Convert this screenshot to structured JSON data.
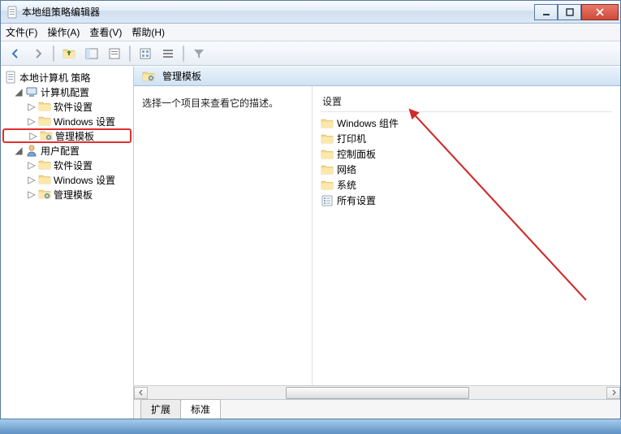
{
  "window": {
    "title": "本地组策略编辑器"
  },
  "menu": {
    "file": "文件(F)",
    "action": "操作(A)",
    "view": "查看(V)",
    "help": "帮助(H)"
  },
  "tree": {
    "root": "本地计算机 策略",
    "computer_config": "计算机配置",
    "user_config": "用户配置",
    "software_settings": "软件设置",
    "windows_settings": "Windows 设置",
    "admin_templates": "管理模板"
  },
  "breadcrumb": {
    "title": "管理模板"
  },
  "description": {
    "hint": "选择一个项目来查看它的描述。"
  },
  "list": {
    "header": "设置",
    "items": [
      {
        "label": "Windows 组件",
        "icon": "folder"
      },
      {
        "label": "打印机",
        "icon": "folder"
      },
      {
        "label": "控制面板",
        "icon": "folder"
      },
      {
        "label": "网络",
        "icon": "folder"
      },
      {
        "label": "系统",
        "icon": "folder"
      },
      {
        "label": "所有设置",
        "icon": "settings"
      }
    ]
  },
  "tabs": {
    "extended": "扩展",
    "standard": "标准"
  }
}
